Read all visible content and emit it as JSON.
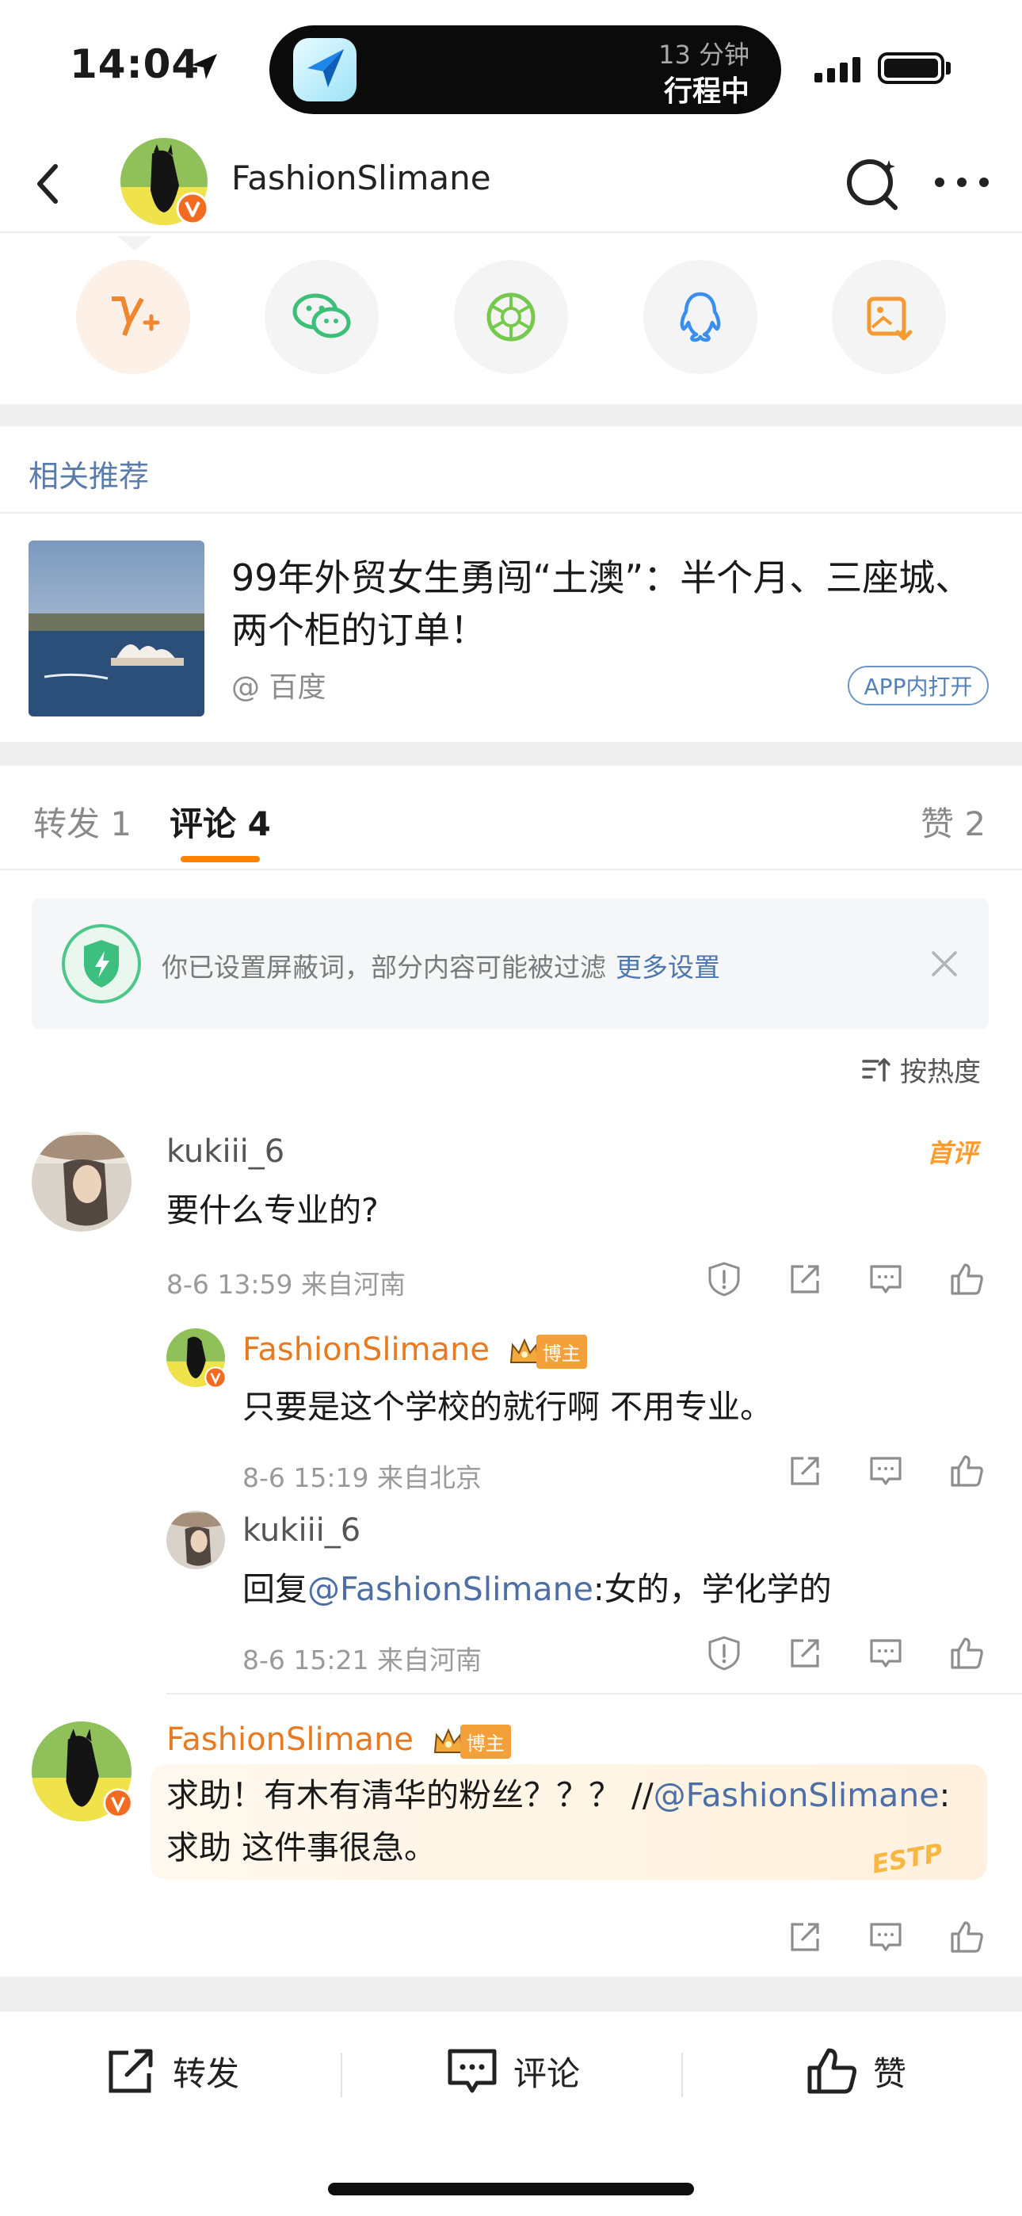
{
  "status_bar": {
    "time": "14:04",
    "island_line1": "13 分钟",
    "island_line2": "行程中"
  },
  "nav": {
    "title": "FashionSlimane"
  },
  "share_row": {
    "icons": [
      "weibo-v-plus-icon",
      "wechat-icon",
      "moments-icon",
      "qq-icon",
      "save-image-icon"
    ]
  },
  "related": {
    "heading": "相关推荐",
    "title": "99年外贸女生勇闯“土澳”：半个月、三座城、两个柜的订单！",
    "source": "@ 百度",
    "open_button": "APP内打开"
  },
  "tabs": {
    "repost": "转发 1",
    "comments": "评论 4",
    "likes": "赞 2"
  },
  "notice": {
    "text": "你已设置屏蔽词，部分内容可能被过滤",
    "link": "更多设置"
  },
  "sort": {
    "label": "按热度"
  },
  "comments": [
    {
      "user": "kukiii_6",
      "badge": "首评",
      "text": "要什么专业的?",
      "meta": "8-6 13:59  来自河南"
    },
    {
      "user": "FashionSlimane",
      "badge": "博主",
      "text": "只要是这个学校的就行啊 不用专业。",
      "meta": "8-6 15:19  来自北京"
    },
    {
      "user": "kukiii_6",
      "reply_prefix": "回复",
      "mention": "@FashionSlimane",
      "text": ":女的，学化学的",
      "meta": "8-6 15:21  来自河南"
    },
    {
      "user": "FashionSlimane",
      "badge": "博主",
      "text_part1": "求助！有木有清华的粉丝？？？ //",
      "mention": "@FashionSlimane",
      "text_part2": ":",
      "text_line2": "求助 这件事很急。",
      "sticker": "ESTP"
    }
  ],
  "bottom_bar": {
    "repost": "转发",
    "comment": "评论",
    "like": "赞"
  },
  "colors": {
    "accent_orange": "#ff8200",
    "username_orange": "#e87a22",
    "link_blue": "#4d77ad",
    "verified_badge": "#f36b21"
  }
}
